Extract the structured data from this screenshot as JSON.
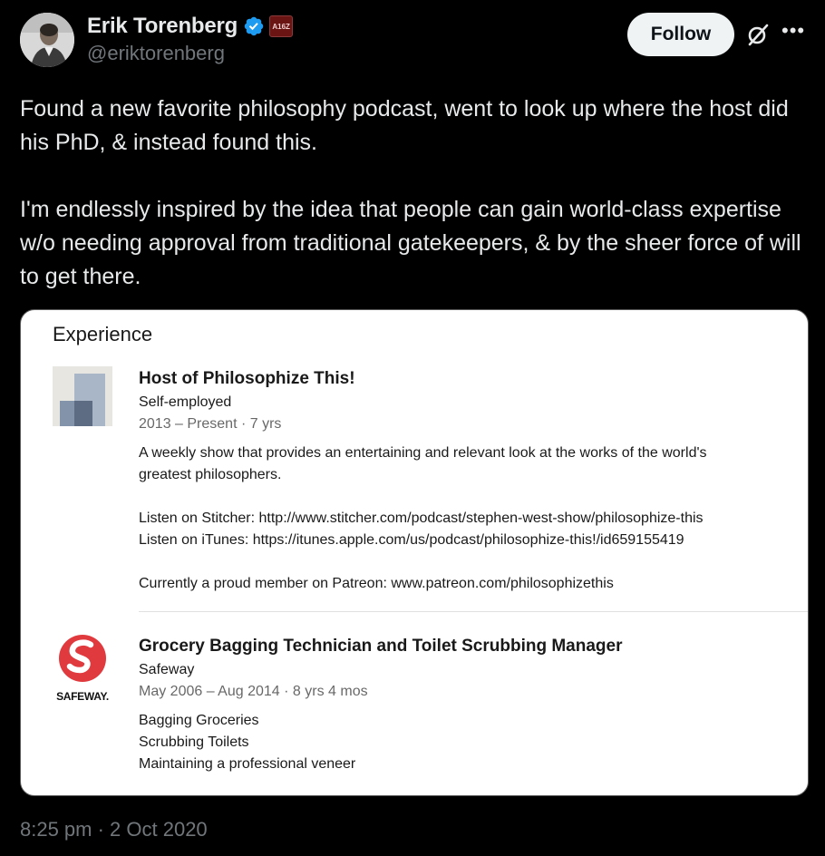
{
  "author": {
    "display_name": "Erik Torenberg",
    "handle": "@eriktorenberg",
    "verified": true,
    "affiliate_badge_text": "A16Z",
    "verified_color": "#1d9bf0"
  },
  "actions": {
    "follow_label": "Follow",
    "grok_icon": "grok-icon",
    "more_icon": "more-icon"
  },
  "tweet": {
    "paragraphs": [
      "Found a new favorite philosophy podcast, went to look up where the host did his PhD, & instead found this.",
      "I'm endlessly inspired by the idea that people can gain world-class expertise w/o needing approval from traditional gatekeepers, & by the sheer force of will to get there."
    ],
    "timestamp": "8:25 pm · 2 Oct 2020"
  },
  "media": {
    "section_title": "Experience",
    "jobs": [
      {
        "title": "Host of Philosophize This!",
        "company": "Self-employed",
        "dates": "2013 – Present · 7 yrs",
        "description": [
          "A weekly show that provides an entertaining and relevant look at the works of the world's",
          "greatest philosophers.",
          "",
          "Listen on Stitcher: http://www.stitcher.com/podcast/stephen-west-show/philosophize-this",
          "Listen on iTunes: https://itunes.apple.com/us/podcast/philosophize-this!/id659155419",
          "",
          "Currently a proud member on Patreon: www.patreon.com/philosophizethis"
        ],
        "logo": "generic-company-logo-icon"
      },
      {
        "title": "Grocery Bagging Technician and Toilet Scrubbing Manager",
        "company": "Safeway",
        "dates": "May 2006 – Aug 2014 · 8 yrs 4 mos",
        "description": [
          "Bagging Groceries",
          "Scrubbing Toilets",
          "Maintaining a professional veneer"
        ],
        "logo": "safeway-logo",
        "logo_text": "SAFEWAY."
      }
    ]
  },
  "colors": {
    "background": "#000000",
    "text": "#e7e9ea",
    "muted": "#71767b",
    "safeway_red": "#e03a3e"
  }
}
